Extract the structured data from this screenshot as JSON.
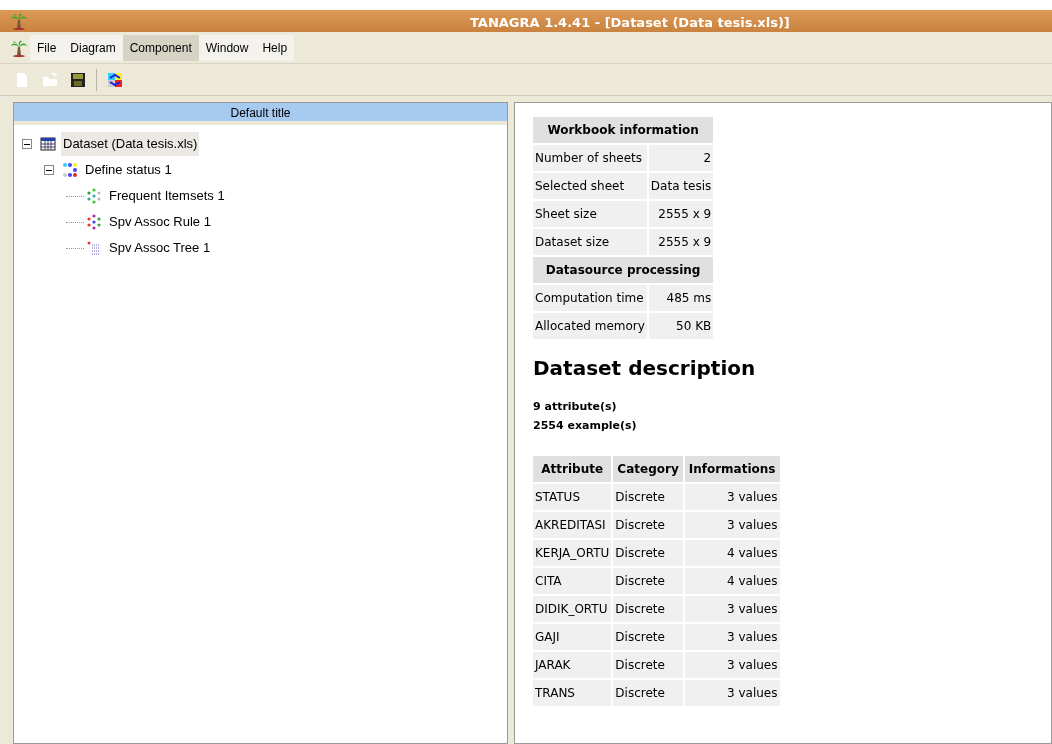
{
  "window": {
    "title": "TANAGRA 1.4.41 - [Dataset (Data tesis.xls)]"
  },
  "menu": [
    {
      "label": "File",
      "selected": false
    },
    {
      "label": "Diagram",
      "selected": false
    },
    {
      "label": "Component",
      "selected": true
    },
    {
      "label": "Window",
      "selected": false
    },
    {
      "label": "Help",
      "selected": false
    }
  ],
  "toolbar": [
    {
      "kind": "new",
      "disabled": true
    },
    {
      "kind": "open",
      "disabled": true
    },
    {
      "kind": "save",
      "disabled": false
    },
    {
      "kind": "separator"
    },
    {
      "kind": "execute",
      "disabled": false
    }
  ],
  "diagram": {
    "title": "Default title",
    "tree": [
      {
        "label": "Dataset (Data tesis.xls)",
        "kind": "table",
        "selected": true,
        "expanded": true,
        "children": [
          {
            "label": "Define status 1",
            "kind": "status",
            "selected": false,
            "expanded": true,
            "children": [
              {
                "label": "Frequent Itemsets 1",
                "kind": "itemsets",
                "selected": false
              },
              {
                "label": "Spv Assoc Rule 1",
                "kind": "rule",
                "selected": false
              },
              {
                "label": "Spv Assoc Tree 1",
                "kind": "tree",
                "selected": false
              }
            ]
          }
        ]
      }
    ]
  },
  "report": {
    "info_table": [
      {
        "kind": "header",
        "label": "Workbook information"
      },
      {
        "kind": "row",
        "key": "Number of sheets",
        "value": "2"
      },
      {
        "kind": "row",
        "key": "Selected sheet",
        "value": "Data tesis"
      },
      {
        "kind": "row",
        "key": "Sheet size",
        "value": "2555 x 9"
      },
      {
        "kind": "row",
        "key": "Dataset size",
        "value": "2555 x 9"
      },
      {
        "kind": "header",
        "label": "Datasource processing"
      },
      {
        "kind": "row",
        "key": "Computation time",
        "value": "485 ms"
      },
      {
        "kind": "row",
        "key": "Allocated memory",
        "value": "50 KB"
      }
    ],
    "heading": "Dataset description",
    "summary": [
      "9 attribute(s)",
      "2554 example(s)"
    ],
    "attributes": {
      "columns": [
        "Attribute",
        "Category",
        "Informations"
      ],
      "rows": [
        [
          "STATUS",
          "Discrete",
          "3 values"
        ],
        [
          "AKREDITASI",
          "Discrete",
          "3 values"
        ],
        [
          "KERJA_ORTU",
          "Discrete",
          "4 values"
        ],
        [
          "CITA",
          "Discrete",
          "4 values"
        ],
        [
          "DIDIK_ORTU",
          "Discrete",
          "3 values"
        ],
        [
          "GAJI",
          "Discrete",
          "3 values"
        ],
        [
          "JARAK",
          "Discrete",
          "3 values"
        ],
        [
          "TRANS",
          "Discrete",
          "3 values"
        ]
      ]
    }
  }
}
